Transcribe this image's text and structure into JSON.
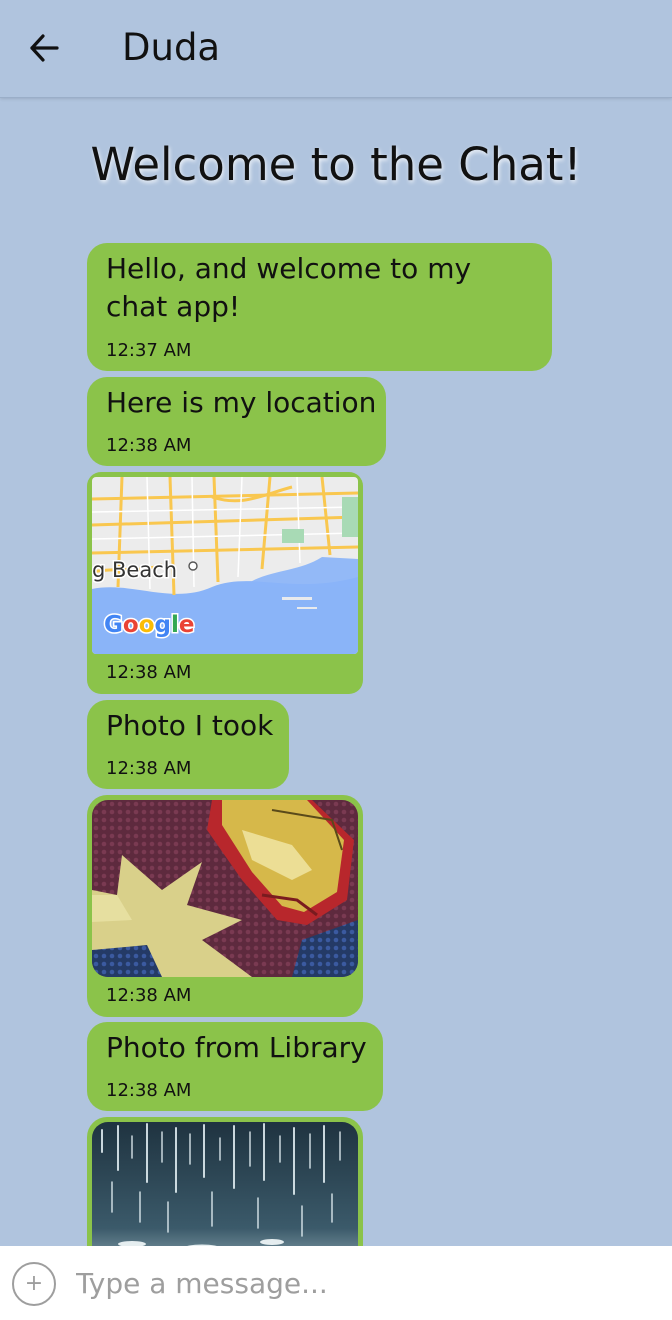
{
  "header": {
    "title": "Duda",
    "back_icon": "arrow-left-icon"
  },
  "chat": {
    "welcome": "Welcome to the Chat!",
    "bubble_color": "#8bc34a",
    "background_color": "#b0c4de",
    "messages": [
      {
        "type": "text",
        "text": "Hello, and welcome to my chat app!",
        "time": "12:37 AM"
      },
      {
        "type": "text",
        "text": "Here is my location",
        "time": "12:38 AM"
      },
      {
        "type": "map",
        "map_place": "g Beach",
        "map_brand": "Google",
        "time": "12:38 AM"
      },
      {
        "type": "text",
        "text": "Photo I took",
        "time": "12:38 AM"
      },
      {
        "type": "photo",
        "time": "12:38 AM"
      },
      {
        "type": "text",
        "text": "Photo from Library",
        "time": "12:38 AM"
      },
      {
        "type": "photo"
      }
    ]
  },
  "composer": {
    "placeholder": "Type a message...",
    "attach_icon": "plus-circle-icon"
  }
}
